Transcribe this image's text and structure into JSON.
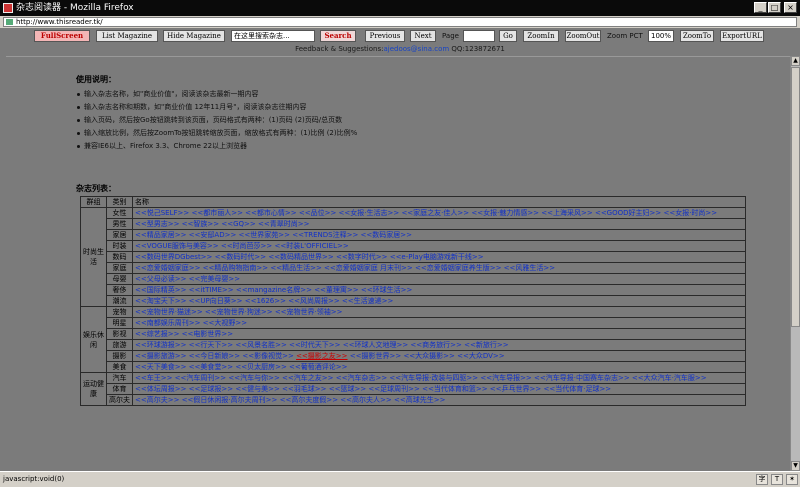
{
  "window": {
    "title": "杂志阅读器 - Mozilla Firefox",
    "min": "_",
    "max": "□",
    "close": "×"
  },
  "url": "http://www.thisreader.tk/",
  "toolbar": {
    "fullscreen": "FullScreen",
    "list": "List Magazine",
    "hide": "Hide Magazine",
    "search_value": "在这里搜索杂志...",
    "search": "Search",
    "previous": "Previous",
    "next": "Next",
    "page_label": "Page",
    "page_value": "",
    "go": "Go",
    "zoomin": "ZoomIn",
    "zoomout": "ZoomOut",
    "zoom_label": "Zoom PCT",
    "zoom_value": "100%",
    "zoomto": "ZoomTo",
    "export": "ExportURL"
  },
  "feedback": {
    "prefix": "Feedback & Suggestions:",
    "email": "ajedoos@sina.com",
    "qq": "QQ:123872671"
  },
  "usage": {
    "title": "使用说明：",
    "items": [
      "输入杂志名称，如\"商业价值\"，阅读该杂志最新一期内容",
      "输入杂志名称和期数，如\"商业价值 12年11月号\"，阅读该杂志往期内容",
      "输入页码，然后按Go按钮跳转到该页面，页码格式有两种：(1)页码 (2)页码/总页数",
      "输入缩放比例，然后按ZoomTo按钮跳转缩放页面，缩放格式有两种：(1)比例 (2)比例%",
      "兼容IE6以上、Firefox 3.3、Chrome 22以上浏览器"
    ]
  },
  "list": {
    "title": "杂志列表：",
    "headers": [
      "群组",
      "类别",
      "名称"
    ],
    "groups": [
      {
        "name": "时尚生活",
        "rows": [
          {
            "cat": "女性",
            "mags": "<<悦己SELF>> <<都市丽人>> <<都市心情>> <<品位>> <<女报·生活志>> <<家庭之友·佳人>> <<女报·魅力情感>> <<上海采风>> <<GOOD好主妇>> <<女报·时尚>>"
          },
          {
            "cat": "男性",
            "mags": "<<型男志>> <<智族>> <<GQ>> <<青翠时尚>>"
          },
          {
            "cat": "家居",
            "mags": "<<精品家居>> <<安邸AD>> <<世界家苑>> <<TRENDS注释>> <<数码家居>>"
          },
          {
            "cat": "时装",
            "mags": "<<VOGUE服饰与美容>> <<时尚芭莎>> <<时装L'OFFICIEL>>"
          },
          {
            "cat": "数码",
            "mags": "<<数码世界DGbest>> <<数码时代>> <<数码精品世界>> <<数字时代>> <<e-Play电脑游戏新干线>>"
          },
          {
            "cat": "家庭",
            "mags": "<<恋爱婚姻家庭>> <<精品购物指南>> <<精品生活>> <<恋爱婚姻家庭 月末刊>> <<恋爱婚姻家庭养生版>> <<风雅生活>>"
          },
          {
            "cat": "母婴",
            "mags": "<<父母必读>> <<完美母婴>>"
          },
          {
            "cat": "奢侈",
            "mags": "<<国际精英>> <<itTIME>> <<mangazine名牌>> <<董理寓>> <<环球生活>>"
          },
          {
            "cat": "潮流",
            "mags": "<<淘宝天下>> <<UP向日葵>> <<1626>> <<风尚周报>> <<生活速递>>"
          }
        ]
      },
      {
        "name": "娱乐休闲",
        "rows": [
          {
            "cat": "宠物",
            "mags": "<<宠物世界·猫迷>> <<宠物世界·狗迷>> <<宠物世界·领袖>>"
          },
          {
            "cat": "明星",
            "mags": "<<南都娱乐周刊>> <<大视野>>"
          },
          {
            "cat": "影视",
            "mags": "<<综艺报>> <<电影世界>>"
          },
          {
            "cat": "旅游",
            "mags": "<<环球游报>> <<行天下>> <<风景名胜>> <<时代天下>> <<环球人文地理>> <<商务旅行>> <<新旅行>>"
          },
          {
            "cat": "摄影",
            "mags": "<<摄影旅游>> <<今日新娘>> <<影像视觉>> <<摄影之友>> <<摄影世界>> <<大众摄影>> <<大众DV>>",
            "hl": "<<摄影之友>>"
          },
          {
            "cat": "美食",
            "mags": "<<天下美食>> <<美食堂>> <<贝太厨房>> <<葡萄酒评论>>"
          }
        ]
      },
      {
        "name": "运动健康",
        "rows": [
          {
            "cat": "汽车",
            "mags": "<<车王>> <<汽车周刊>> <<汽车与你>> <<汽车之友>> <<汽车杂志>> <<汽车导报·改装与四驱>> <<汽车导报>> <<汽车导报·中国赛车杂志>> <<大众汽车·汽车服>>"
          },
          {
            "cat": "体育",
            "mags": "<<体坛周报>> <<足球报>> <<健与美>> <<羽毛球>> <<篮球>> <<足球周刊>> <<当代体育和篮>> <<乒乓世界>> <<当代体育·足球>>"
          },
          {
            "cat": "高尔夫",
            "mags": "<<高尔夫>> <<假日休闲报·高尔夫周刊>> <<高尔夫度假>> <<高尔夫人>> <<高球先生>>"
          }
        ]
      }
    ]
  },
  "status": {
    "text": "javascript:void(0)"
  }
}
